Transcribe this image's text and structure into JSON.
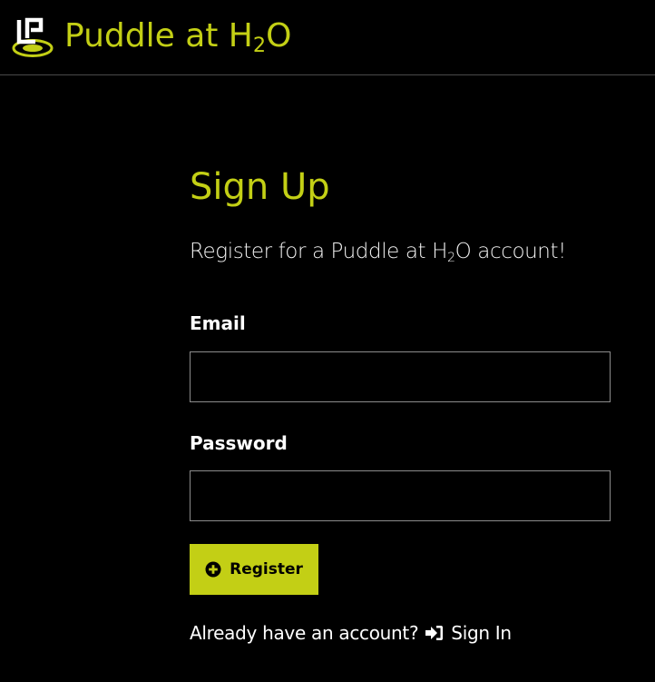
{
  "header": {
    "brand_name_prefix": "Puddle at H",
    "brand_name_sub": "2",
    "brand_name_suffix": "O",
    "logo_icon": "puddle-logo-icon"
  },
  "signup": {
    "title": "Sign Up",
    "subtitle_prefix": "Register for a Puddle at H",
    "subtitle_sub": "2",
    "subtitle_suffix": "O account!",
    "email_label": "Email",
    "email_value": "",
    "password_label": "Password",
    "password_value": "",
    "register_button": "Register",
    "register_icon": "plus-circle-icon",
    "already_text": "Already have an account?",
    "signin_link": "Sign In",
    "signin_icon": "sign-in-icon"
  },
  "colors": {
    "background": "#000000",
    "accent": "#c3cf15",
    "text": "#ffffff",
    "field_border": "#8c8c8c",
    "divider": "#4a4a4a"
  }
}
